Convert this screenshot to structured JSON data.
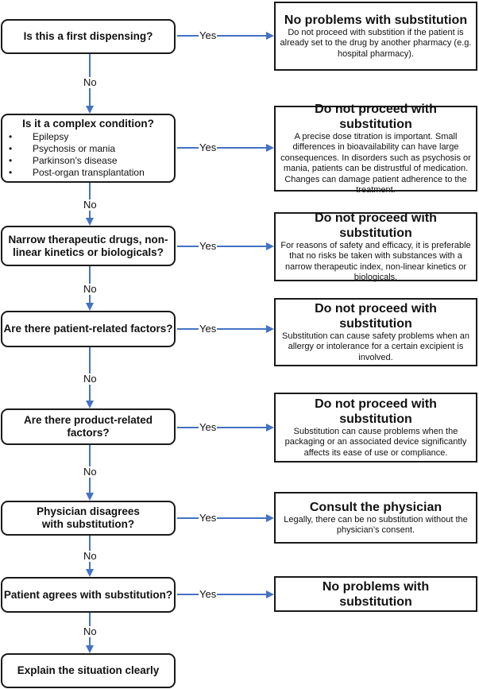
{
  "colors": {
    "connector": "#4472c4",
    "border": "#1a1a1a"
  },
  "labels": {
    "yes": "Yes",
    "no": "No"
  },
  "questions": [
    {
      "text": "Is this a first dispensing?"
    },
    {
      "text": "Is it a complex condition?",
      "items": [
        "Epilepsy",
        "Psychosis or mania",
        "Parkinson’s disease",
        "Post-organ transplantation"
      ]
    },
    {
      "text": "Narrow therapeutic drugs, non-linear kinetics or biologicals?"
    },
    {
      "text": "Are there patient-related factors?"
    },
    {
      "text": "Are there product-related factors?"
    },
    {
      "text": "Physician disagrees with substitution?"
    },
    {
      "text": "Patient agrees with substitution?"
    },
    {
      "text": "Explain the situation clearly"
    }
  ],
  "outcomes": [
    {
      "title": "No problems with substitution",
      "body": "Do not proceed with substition if the patient is already set to the drug by another pharmacy (e.g. hospital pharmacy)."
    },
    {
      "title": "Do not proceed with substitution",
      "body": "A precise dose titration is important. Small differences in bioavailability can have large consequences. In disorders such as psychosis or mania, patients can be distrustful of medication. Changes can damage patient adherence to the treatment."
    },
    {
      "title": "Do not proceed with substitution",
      "body": "For reasons of safety and efficacy, it is preferable that no risks be taken with substances with a narrow therapeutic index, non-linear kinetics or biologicals."
    },
    {
      "title": "Do not proceed with substitution",
      "body": "Substitution can cause safety problems when an allergy or intolerance for a certain excipient is involved."
    },
    {
      "title": "Do not proceed with substitution",
      "body": "Substitution can cause problems when the packaging or an associated device significantly affects its ease of use or compliance."
    },
    {
      "title": "Consult the physician",
      "body": "Legally, there can be no substitution without the physician’s consent."
    },
    {
      "title": "No problems with substitution",
      "body": ""
    }
  ]
}
